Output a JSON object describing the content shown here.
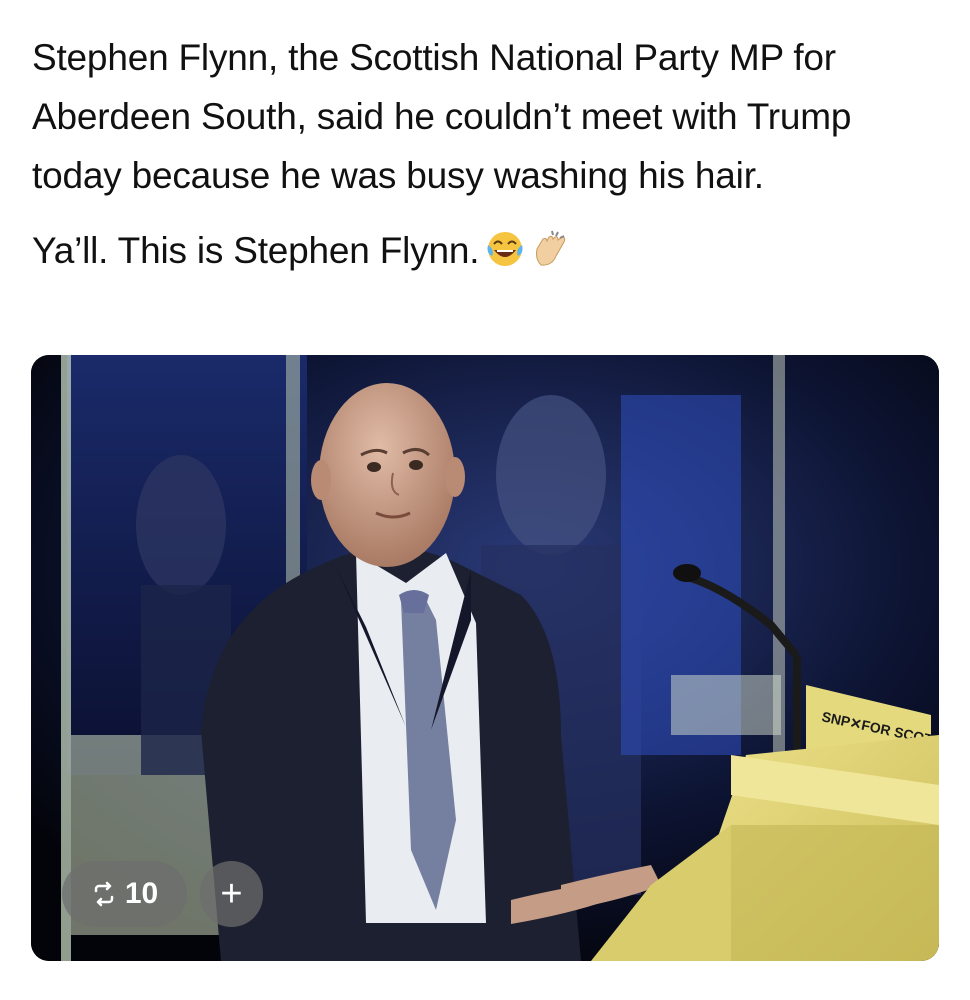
{
  "post": {
    "paragraphs": [
      "Stephen Flynn, the Scottish National Party MP for Aberdeen South, said he couldn’t meet with Trump today because he was busy washing his hair.",
      "Ya’ll. This is Stephen Flynn."
    ],
    "emojis": [
      "face-with-tears-of-joy-icon",
      "clapping-hands-icon"
    ]
  },
  "media": {
    "alt_subject": "man in dark suit at yellow lectern with microphone",
    "lectern_sign": "SNP✕FOR SCOTLAND",
    "repost_count": "10",
    "add_label": "+"
  },
  "colors": {
    "lectern": "#e3d77a",
    "suit": "#1d2030",
    "tie": "#7580a0",
    "skin": "#c8a08a",
    "chip_bg": "#6e6e6e"
  }
}
